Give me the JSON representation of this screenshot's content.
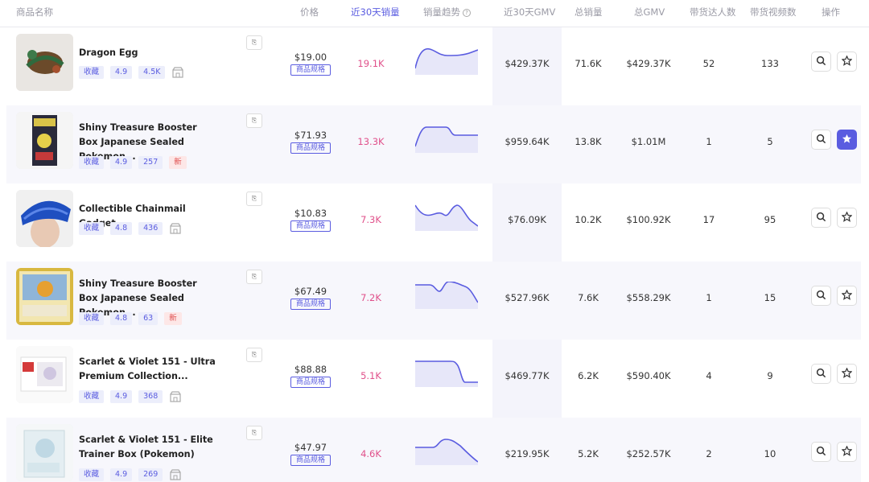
{
  "header": {
    "name": "商品名称",
    "price": "价格",
    "sales30": "近30天销量",
    "trend": "销量趋势",
    "gmv30": "近30天GMV",
    "total_sales": "总销量",
    "total_gmv": "总GMV",
    "influencers": "带货达人数",
    "videos": "带货视频数",
    "actions": "操作"
  },
  "colors": {
    "accent": "#5a5ce0",
    "sales_pink": "#e0508a",
    "new_red": "#e05050"
  },
  "labels": {
    "fav": "收藏",
    "spec": "商品规格",
    "new": "新"
  },
  "rows": [
    {
      "name": "Dragon Egg",
      "rating": "4.9",
      "reviews": "4.5K",
      "is_new": false,
      "price": "$19.00",
      "sales30": "19.1K",
      "gmv30": "$429.37K",
      "total_sales": "71.6K",
      "total_gmv": "$429.37K",
      "influencers": "52",
      "videos": "133",
      "starred": false
    },
    {
      "name": "Shiny Treasure Booster Box Japanese Sealed Pokemon...",
      "rating": "4.9",
      "reviews": "257",
      "is_new": true,
      "price": "$71.93",
      "sales30": "13.3K",
      "gmv30": "$959.64K",
      "total_sales": "13.8K",
      "total_gmv": "$1.01M",
      "influencers": "1",
      "videos": "5",
      "starred": true
    },
    {
      "name": "Collectible Chainmail Gadget",
      "rating": "4.8",
      "reviews": "436",
      "is_new": false,
      "price": "$10.83",
      "sales30": "7.3K",
      "gmv30": "$76.09K",
      "total_sales": "10.2K",
      "total_gmv": "$100.92K",
      "influencers": "17",
      "videos": "95",
      "starred": false
    },
    {
      "name": "Shiny Treasure Booster Box Japanese Sealed Pokemon...",
      "rating": "4.8",
      "reviews": "63",
      "is_new": true,
      "price": "$67.49",
      "sales30": "7.2K",
      "gmv30": "$527.96K",
      "total_sales": "7.6K",
      "total_gmv": "$558.29K",
      "influencers": "1",
      "videos": "15",
      "starred": false
    },
    {
      "name": "Scarlet & Violet 151 - Ultra Premium Collection...",
      "rating": "4.9",
      "reviews": "368",
      "is_new": false,
      "price": "$88.88",
      "sales30": "5.1K",
      "gmv30": "$469.77K",
      "total_sales": "6.2K",
      "total_gmv": "$590.40K",
      "influencers": "4",
      "videos": "9",
      "starred": false
    },
    {
      "name": "Scarlet & Violet 151 - Elite Trainer Box (Pokemon)",
      "rating": "4.9",
      "reviews": "269",
      "is_new": false,
      "price": "$47.97",
      "sales30": "4.6K",
      "gmv30": "$219.95K",
      "total_sales": "5.2K",
      "total_gmv": "$252.57K",
      "influencers": "2",
      "videos": "10",
      "starred": false
    }
  ]
}
